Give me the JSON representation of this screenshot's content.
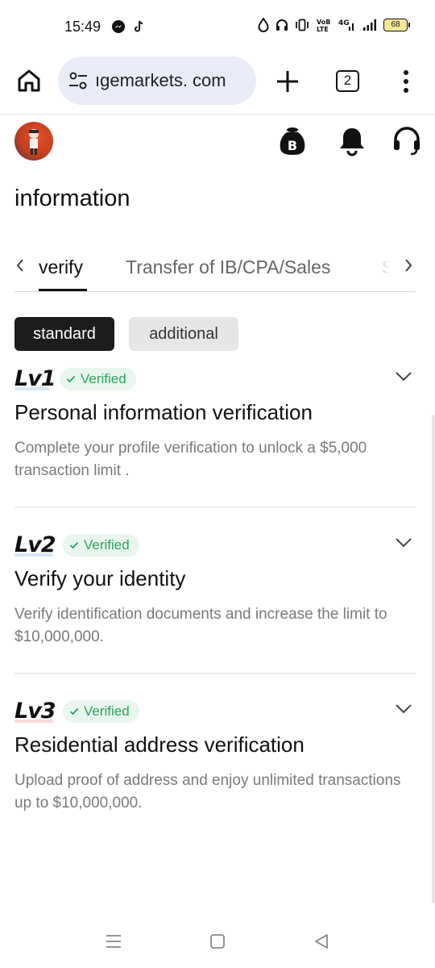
{
  "status_bar": {
    "time": "15:49",
    "battery": "68",
    "left_icons": [
      "messenger-icon",
      "tiktok-icon"
    ],
    "right_icons": [
      "drop-icon",
      "headset-icon",
      "vibrate-icon",
      "volte-icon",
      "4g-signal-icon",
      "signal-icon",
      "battery-icon"
    ]
  },
  "browser": {
    "url": "ıgemarkets. com",
    "tab_count": "2"
  },
  "page": {
    "title": "information"
  },
  "tabs": [
    {
      "label": "verify",
      "active": true
    },
    {
      "label": "Transfer of IB/CPA/Sales",
      "active": false
    },
    {
      "label": "S",
      "active": false
    }
  ],
  "segments": {
    "standard": "standard",
    "additional": "additional"
  },
  "levels": [
    {
      "tag": "Lv1",
      "badge": "Verified",
      "title": "Personal information verification",
      "description": "Complete your profile verification to unlock a $5,000 transaction limit ."
    },
    {
      "tag": "Lv2",
      "badge": "Verified",
      "title": "Verify your identity",
      "description": "Verify identification documents and increase the limit to $10,000,000."
    },
    {
      "tag": "Lv3",
      "badge": "Verified",
      "title": "Residential address verification",
      "description": "Upload proof of address and enjoy unlimited transactions up to $10,000,000."
    }
  ],
  "colors": {
    "verified_green": "#2aa35d",
    "verified_bg": "#e8f6ee",
    "segment_active": "#1c1c1c",
    "segment_inactive": "#e6e6e6",
    "url_pill": "#e8ecf6"
  }
}
